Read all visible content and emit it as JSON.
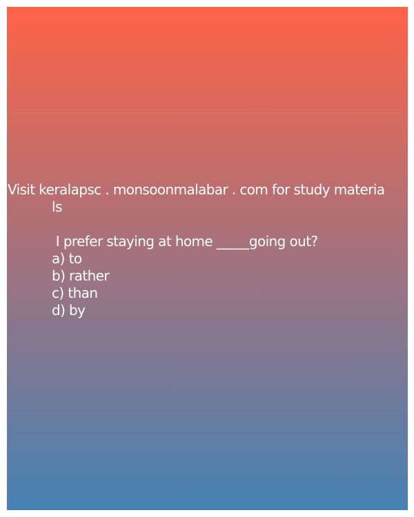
{
  "header": {
    "site_line1": "Visit keralapsc . monsoonmalabar . com for study materia",
    "site_line2": "ls"
  },
  "question": {
    "text": " I prefer staying at home _____going out?"
  },
  "options": [
    {
      "label": "a) to"
    },
    {
      "label": "b) rather"
    },
    {
      "label": "c) than"
    },
    {
      "label": "d) by"
    }
  ],
  "colors": {
    "gradient_top": "#ff6347",
    "gradient_bottom": "#4682b4",
    "text": "#ffffff"
  }
}
